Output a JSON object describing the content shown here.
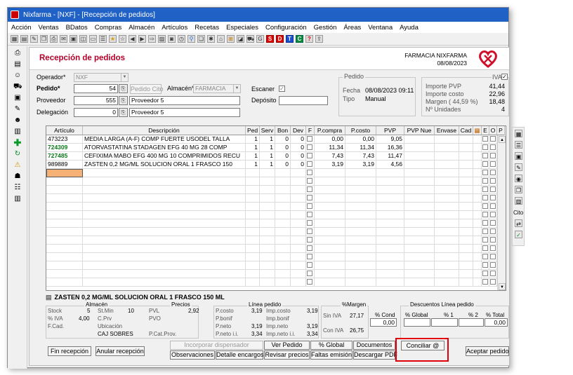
{
  "window": {
    "title": "Nixfarma - [NXF] - [Recepción de pedidos]"
  },
  "menu": [
    "Acción",
    "Ventas",
    "BDatos",
    "Compras",
    "Almacén",
    "Artículos",
    "Recetas",
    "Especiales",
    "Configuración",
    "Gestión",
    "Áreas",
    "Ventana",
    "Ayuda"
  ],
  "toolbar": {
    "letters": [
      "G",
      "S",
      "D",
      "T",
      "C",
      "?"
    ]
  },
  "header": {
    "title": "Recepción de pedidos",
    "pharmacy": "FARMACIA NIXFARMA",
    "date": "08/08/2023"
  },
  "form": {
    "operador_label": "Operador*",
    "operador_value": "NXF",
    "pedido_label": "Pedido*",
    "pedido_value": "54",
    "pedido_cito_btn": "Pedido Cito",
    "almacen_label": "Almacén*",
    "almacen_value": "FARMACIA",
    "escaner_label": "Escaner",
    "escaner_checked": "✓",
    "proveedor_label": "Proveedor",
    "proveedor_code": "555",
    "proveedor_name": "Proveedor 5",
    "deposito_label": "Depósito",
    "deposito_value": "",
    "delegacion_label": "Delegación",
    "delegacion_code": "0",
    "delegacion_name": "Proveedor 5"
  },
  "pedido_box": {
    "title": "Pedido",
    "fecha_label": "Fecha",
    "fecha_value": "08/08/2023 09:11",
    "tipo_label": "Tipo",
    "tipo_value": "Manual"
  },
  "iva_box": {
    "iva_label": "IVA",
    "iva_checked": "✓",
    "importe_pvp_label": "Importe PVP",
    "importe_pvp": "41,44",
    "importe_costo_label": "Importe costo",
    "importe_costo": "22,96",
    "margen_label": "Margen ( 44,59 %)",
    "margen": "18,48",
    "unidades_label": "Nº Unidades",
    "unidades": "4"
  },
  "grid": {
    "headers": [
      "Artículo",
      "Descripción",
      "Ped",
      "Serv",
      "Bon",
      "Dev",
      "F",
      "P.compra",
      "P.costo",
      "PVP",
      "PVP Nue",
      "Envase",
      "Cad",
      "",
      "E",
      "O",
      "P"
    ],
    "rows": [
      {
        "code": "473223",
        "desc": "MEDIA LARGA (A-F) COMP FUERTE USODEL TALLA",
        "ped": "1",
        "serv": "1",
        "bon": "0",
        "dev": "0",
        "pcompra": "0,00",
        "pcosto": "0,00",
        "pvp": "9,05",
        "color": "#000000"
      },
      {
        "code": "724309",
        "desc": "ATORVASTATINA STADAGEN EFG 40 MG 28 COMP",
        "ped": "1",
        "serv": "1",
        "bon": "0",
        "dev": "0",
        "pcompra": "11,34",
        "pcosto": "11,34",
        "pvp": "16,36",
        "color": "#0a7a1a"
      },
      {
        "code": "727485",
        "desc": "CEFIXIMA MABO EFG 400 MG 10 COMPRIMIDOS RECU",
        "ped": "1",
        "serv": "1",
        "bon": "0",
        "dev": "0",
        "pcompra": "7,43",
        "pcosto": "7,43",
        "pvp": "11,47",
        "color": "#0a7a1a"
      },
      {
        "code": "989889",
        "desc": "ZASTEN 0,2 MG/ML SOLUCION ORAL 1 FRASCO 150",
        "ped": "1",
        "serv": "1",
        "bon": "0",
        "dev": "0",
        "pcompra": "3,19",
        "pcosto": "3,19",
        "pvp": "4,56",
        "color": "#000000"
      }
    ]
  },
  "selected_desc": "ZASTEN 0,2 MG/ML SOLUCION ORAL 1 FRASCO 150 ML",
  "bottom": {
    "almacen_title": "Almacén",
    "stock_label": "Stock",
    "stock": "5",
    "stmin_label": "St.Min",
    "stmin": "10",
    "iva_pct_label": "% IVA",
    "iva_pct": "4,00",
    "cprv_label": "C.Prv",
    "fcad_label": "F.Cad.",
    "ubicacion_label": "Ubicación",
    "ubicacion": "CAJ SOBRES",
    "precios_title": "Precios",
    "pvl_label": "PVL",
    "pvl": "2,92",
    "pvo_label": "PVO",
    "pcatprov_label": "P.Cat.Prov.",
    "linea_title": "Línea pedido",
    "pcosto_label": "P.costo",
    "pcosto": "3,19",
    "impcosto_label": "Imp.costo",
    "impcosto": "3,19",
    "pbonif_label": "P.bonif",
    "impbonif_label": "Imp.bonif",
    "pneto_label": "P.neto",
    "pneto": "3,19",
    "impneto_label": "Imp.neto",
    "impneto": "3,19",
    "pnetoii_label": "P.neto i.i.",
    "pnetoii": "3,34",
    "impnetoii_label": "Imp.neto i.i.",
    "impnetoii": "3,34",
    "margen_title": "%Margen",
    "siniva_label": "Sin IVA",
    "siniva": "27,17",
    "coniva_label": "Con IVA",
    "coniva": "26,75",
    "cond_label": "% Cond",
    "cond": "0,00",
    "desc_title": "Descuentos Línea pedido",
    "global_label": "% Global",
    "d1_label": "% 1",
    "d2_label": "% 2",
    "total_label": "% Total",
    "total": "0,00"
  },
  "buttons": {
    "fin": "Fin recepción",
    "anular": "Anular recepción",
    "incorporar": "Incorporar dispensador",
    "observaciones": "Observaciones",
    "ver_pedido": "Ver Pedido",
    "detalle": "Detalle encargos",
    "revisar": "Revisar precios",
    "global": "% Global",
    "faltas": "Faltas emisión",
    "documentos": "Documentos",
    "descargar": "Descargar PDF",
    "conciliar": "Conciliar @",
    "aceptar": "Aceptar pedido"
  },
  "rightbar": {
    "cito_label": "Cito"
  }
}
